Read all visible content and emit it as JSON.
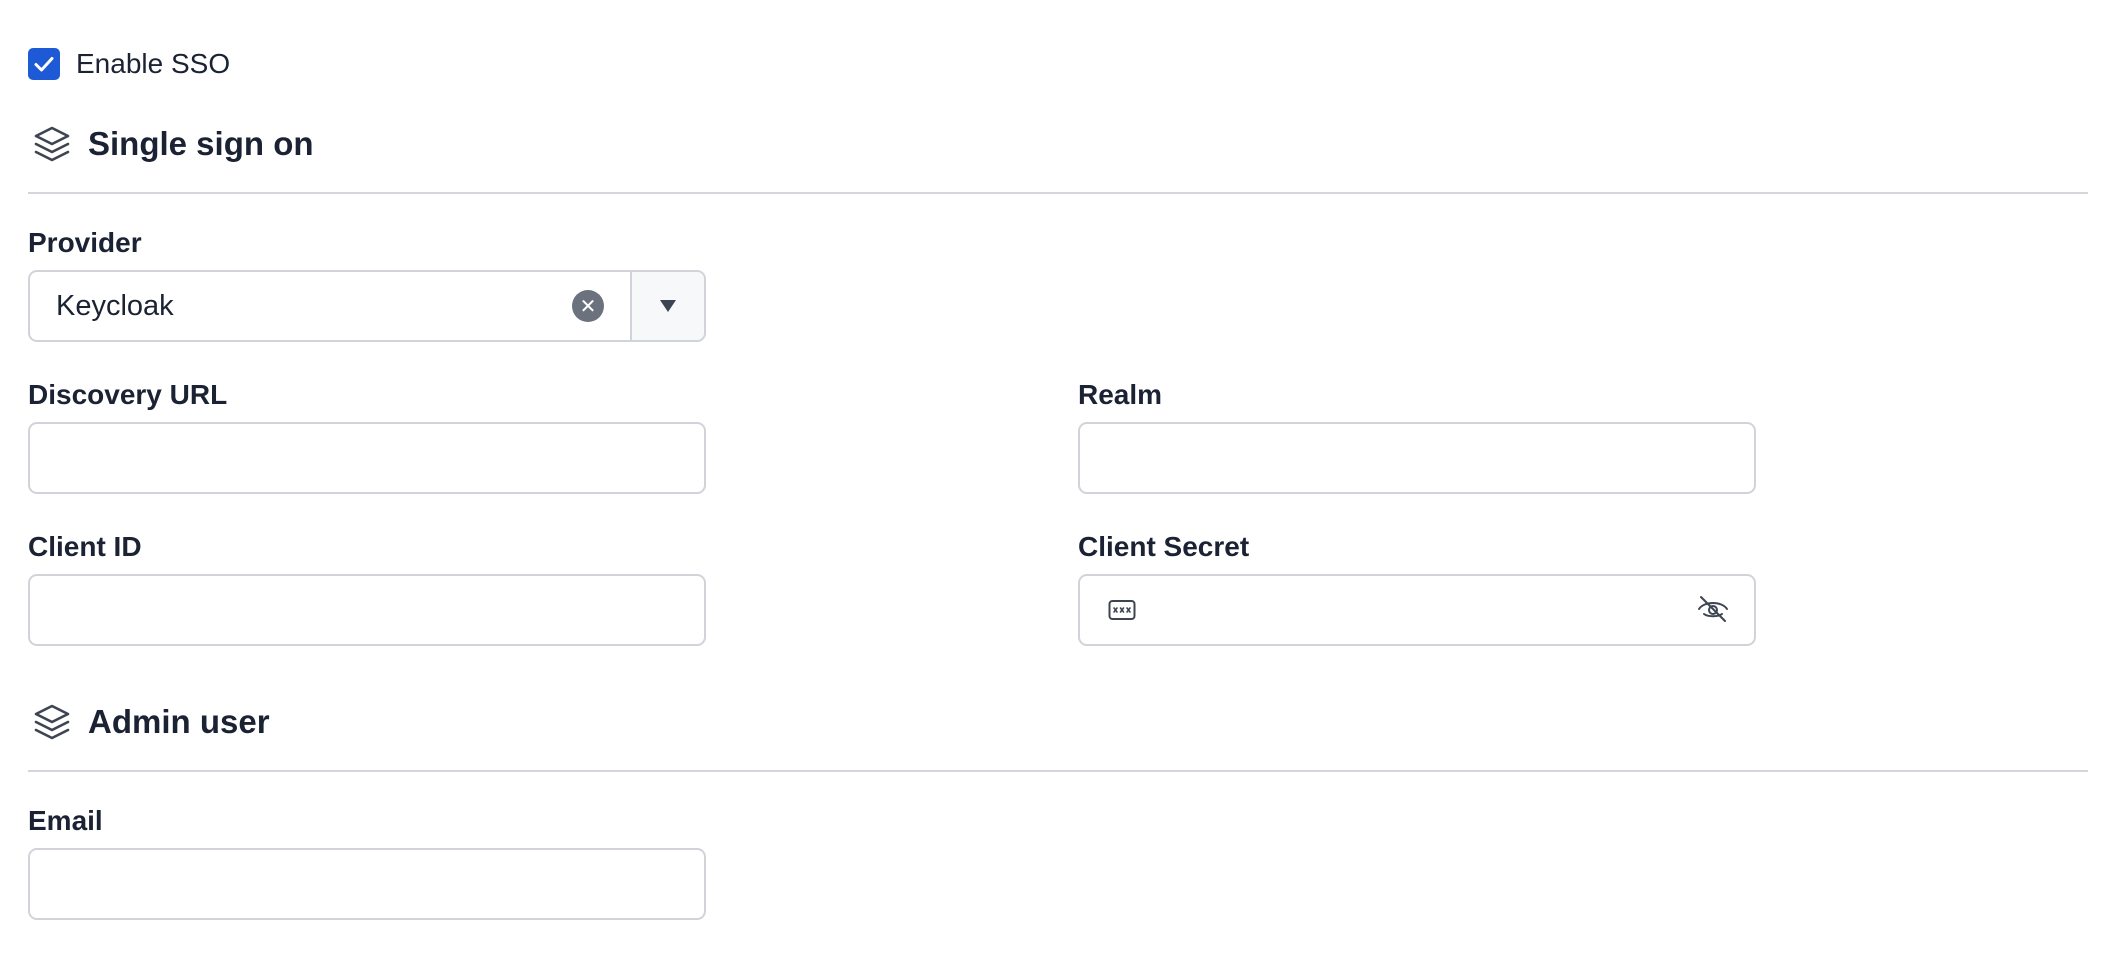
{
  "sso": {
    "enable_label": "Enable SSO",
    "enabled": true
  },
  "sections": {
    "single_sign_on": {
      "title": "Single sign on",
      "icon": "layers-icon"
    },
    "admin_user": {
      "title": "Admin user",
      "icon": "layers-icon"
    }
  },
  "fields": {
    "provider": {
      "label": "Provider",
      "value": "Keycloak"
    },
    "discovery_url": {
      "label": "Discovery URL",
      "value": ""
    },
    "realm": {
      "label": "Realm",
      "value": ""
    },
    "client_id": {
      "label": "Client ID",
      "value": ""
    },
    "client_secret": {
      "label": "Client Secret",
      "value": ""
    },
    "email": {
      "label": "Email",
      "value": ""
    }
  },
  "colors": {
    "accent": "#1f5ad6",
    "text": "#1a2233",
    "border": "#d0d3d8",
    "divider": "#d3d6db",
    "clear_badge": "#6c727d"
  }
}
